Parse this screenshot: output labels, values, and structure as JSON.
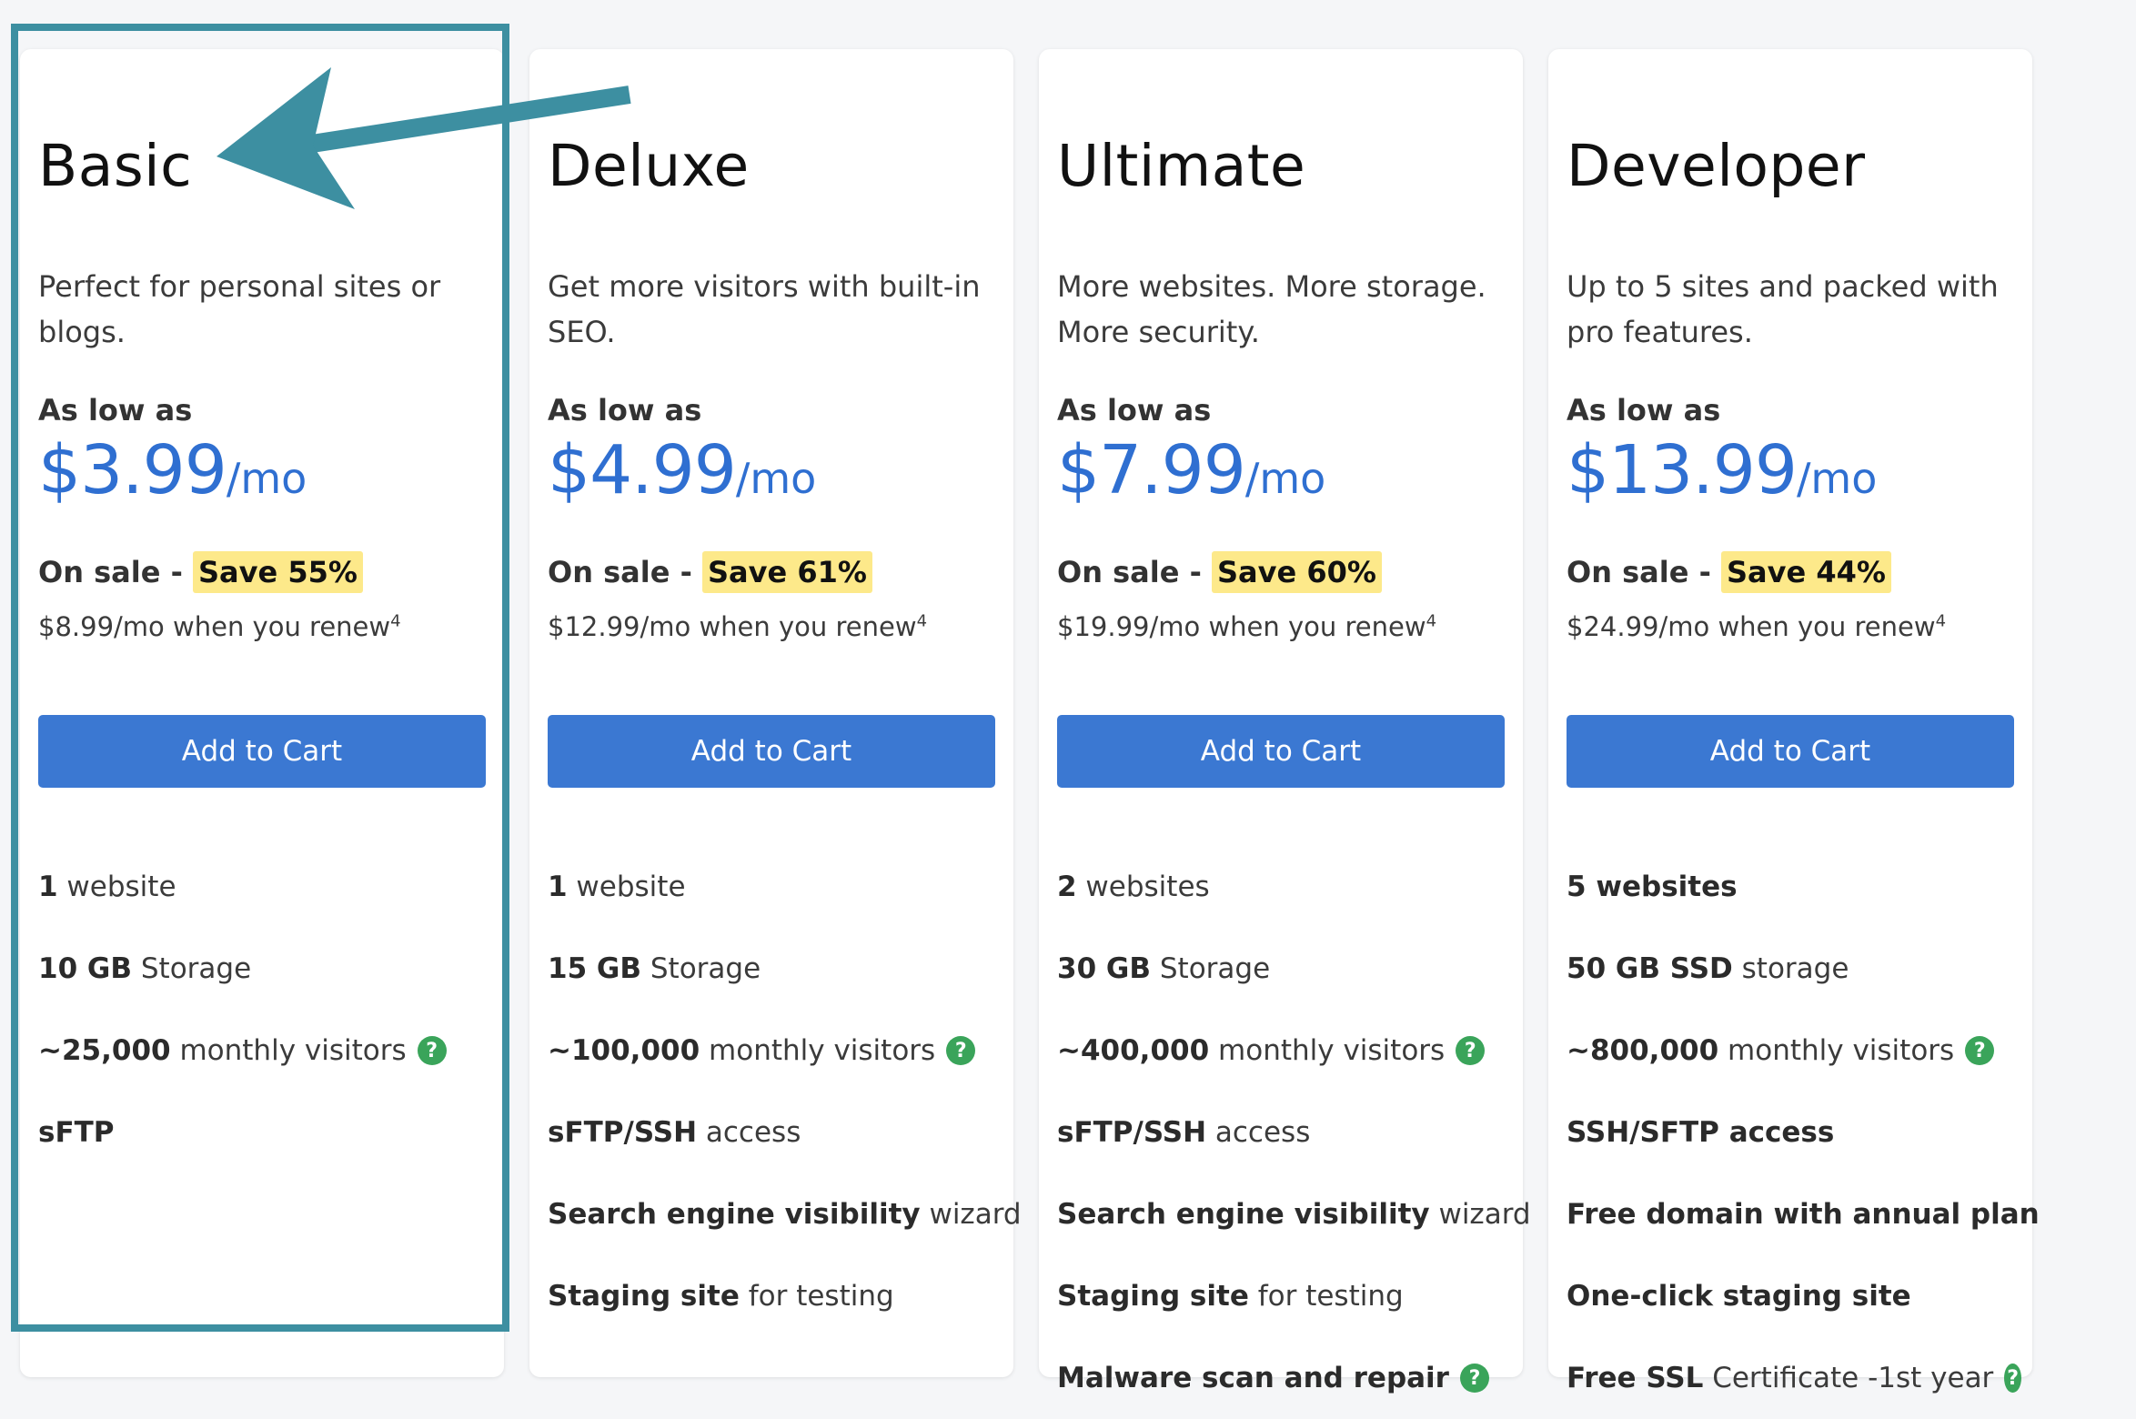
{
  "plans": [
    {
      "title": "Basic",
      "description": "Perfect for personal sites or blogs.",
      "as_low_as": "As low as",
      "price": "$3.99",
      "price_unit": "/mo",
      "sale_label": "On sale -",
      "save": "Save 55%",
      "renew": "$8.99/mo when you renew",
      "renew_note": "4",
      "cta": "Add to Cart",
      "features": [
        {
          "parts": [
            {
              "t": "1",
              "b": true
            },
            {
              "t": " website",
              "b": false
            }
          ],
          "help": false
        },
        {
          "parts": [
            {
              "t": "10 GB",
              "b": true
            },
            {
              "t": " Storage",
              "b": false
            }
          ],
          "help": false
        },
        {
          "parts": [
            {
              "t": "~25,000",
              "b": true
            },
            {
              "t": " monthly visitors",
              "b": false
            }
          ],
          "help": true
        },
        {
          "parts": [
            {
              "t": "sFTP",
              "b": true
            }
          ],
          "help": false
        }
      ]
    },
    {
      "title": "Deluxe",
      "description": "Get more visitors with built-in SEO.",
      "as_low_as": "As low as",
      "price": "$4.99",
      "price_unit": "/mo",
      "sale_label": "On sale -",
      "save": "Save 61%",
      "renew": "$12.99/mo when you renew",
      "renew_note": "4",
      "cta": "Add to Cart",
      "features": [
        {
          "parts": [
            {
              "t": "1",
              "b": true
            },
            {
              "t": " website",
              "b": false
            }
          ],
          "help": false
        },
        {
          "parts": [
            {
              "t": "15 GB",
              "b": true
            },
            {
              "t": " Storage",
              "b": false
            }
          ],
          "help": false
        },
        {
          "parts": [
            {
              "t": "~100,000",
              "b": true
            },
            {
              "t": " monthly visitors",
              "b": false
            }
          ],
          "help": true
        },
        {
          "parts": [
            {
              "t": "sFTP/SSH",
              "b": true
            },
            {
              "t": " access",
              "b": false
            }
          ],
          "help": false
        },
        {
          "parts": [
            {
              "t": "Search engine visibility",
              "b": true
            },
            {
              "t": " wizard",
              "b": false
            }
          ],
          "help": false
        },
        {
          "parts": [
            {
              "t": "Staging site",
              "b": true
            },
            {
              "t": " for testing",
              "b": false
            }
          ],
          "help": false
        }
      ]
    },
    {
      "title": "Ultimate",
      "description": "More websites. More storage. More security.",
      "as_low_as": "As low as",
      "price": "$7.99",
      "price_unit": "/mo",
      "sale_label": "On sale -",
      "save": "Save 60%",
      "renew": "$19.99/mo when you renew",
      "renew_note": "4",
      "cta": "Add to Cart",
      "features": [
        {
          "parts": [
            {
              "t": "2",
              "b": true
            },
            {
              "t": " websites",
              "b": false
            }
          ],
          "help": false
        },
        {
          "parts": [
            {
              "t": "30 GB",
              "b": true
            },
            {
              "t": " Storage",
              "b": false
            }
          ],
          "help": false
        },
        {
          "parts": [
            {
              "t": "~400,000",
              "b": true
            },
            {
              "t": " monthly visitors",
              "b": false
            }
          ],
          "help": true
        },
        {
          "parts": [
            {
              "t": "sFTP/SSH",
              "b": true
            },
            {
              "t": " access",
              "b": false
            }
          ],
          "help": false
        },
        {
          "parts": [
            {
              "t": "Search engine visibility",
              "b": true
            },
            {
              "t": " wizard",
              "b": false
            }
          ],
          "help": false
        },
        {
          "parts": [
            {
              "t": "Staging site",
              "b": true
            },
            {
              "t": " for testing",
              "b": false
            }
          ],
          "help": false
        },
        {
          "parts": [
            {
              "t": "Malware scan and repair",
              "b": true
            }
          ],
          "help": true
        }
      ]
    },
    {
      "title": "Developer",
      "description": "Up to 5 sites and packed with pro features.",
      "as_low_as": "As low as",
      "price": "$13.99",
      "price_unit": "/mo",
      "sale_label": "On sale -",
      "save": "Save 44%",
      "renew": "$24.99/mo when you renew",
      "renew_note": "4",
      "cta": "Add to Cart",
      "features": [
        {
          "parts": [
            {
              "t": "5 websites",
              "b": true
            }
          ],
          "help": false
        },
        {
          "parts": [
            {
              "t": "50 GB SSD",
              "b": true
            },
            {
              "t": " storage",
              "b": false
            }
          ],
          "help": false
        },
        {
          "parts": [
            {
              "t": "~800,000",
              "b": true
            },
            {
              "t": " monthly visitors",
              "b": false
            }
          ],
          "help": true
        },
        {
          "parts": [
            {
              "t": "SSH/SFTP access",
              "b": true
            }
          ],
          "help": false
        },
        {
          "parts": [
            {
              "t": "Free domain with annual plan",
              "b": true
            }
          ],
          "help": false
        },
        {
          "parts": [
            {
              "t": "One-click staging site",
              "b": true
            }
          ],
          "help": false
        },
        {
          "parts": [
            {
              "t": "Free SSL",
              "b": true
            },
            {
              "t": " Certificate -1st year",
              "b": false
            }
          ],
          "help": true
        }
      ]
    }
  ],
  "help_icon_glyph": "?",
  "colors": {
    "accent": "#3b78d2",
    "price": "#2f6fd1",
    "save_highlight": "#fde98a",
    "help_icon": "#3aa45a",
    "annotation": "#3d8fa1"
  },
  "annotation": {
    "highlighted_plan": "Basic",
    "arrow_icon": "arrow-left-icon"
  }
}
